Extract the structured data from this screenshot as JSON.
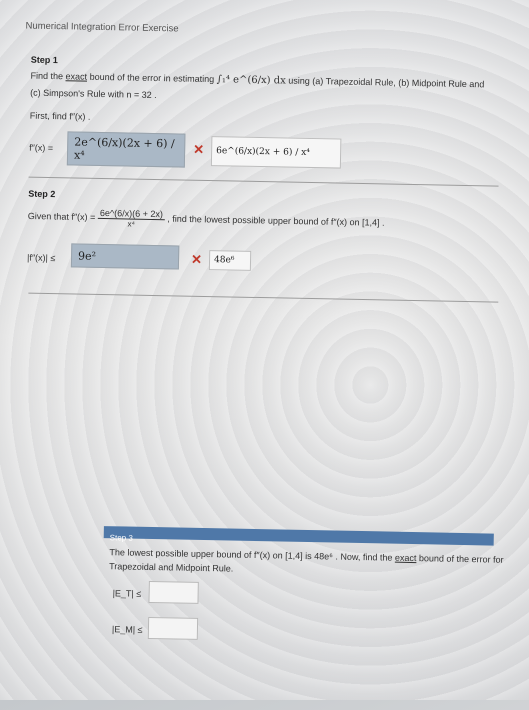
{
  "header": {
    "title": "Numerical Integration Error Exercise"
  },
  "step1": {
    "label": "Step 1",
    "instruction_a": "Find the",
    "instruction_b": "exact",
    "instruction_c": "bound of the error in estimating",
    "integral": "∫₁⁴ e^(6/x) dx",
    "instruction_d": "using (a) Trapezoidal Rule, (b) Midpoint Rule and",
    "instruction_e": "(c) Simpson's Rule with  n = 32 .",
    "first_find": "First, find  f″(x) .",
    "fpp_label": "f″(x) =",
    "answer_entered": "2e^(6/x)(2x + 6) / x⁴",
    "answer_correct": "6e^(6/x)(2x + 6) / x⁴"
  },
  "step2": {
    "label": "Step 2",
    "given_a": "Given that  f″(x) =",
    "given_expr_num": "6e^(6/x)(6 + 2x)",
    "given_expr_den": "x⁴",
    "given_b": ", find the lowest possible upper bound of  f″(x)  on [1,4] .",
    "bound_label": "|f″(x)| ≤",
    "bound_entered": "9e²",
    "bound_correct": "48e⁶"
  },
  "step3": {
    "label": "Step 3",
    "text_a": "The lowest possible upper bound of  f″(x)  on [1,4]  is  48e⁶ .  Now, find the",
    "text_b": "exact",
    "text_c": "bound of the error for",
    "text_d": "Trapezoidal and Midpoint Rule.",
    "et_label": "|E_T| ≤",
    "em_label": "|E_M| ≤",
    "et_value": "",
    "em_value": ""
  },
  "colors": {
    "wrong": "#c0392b",
    "step3_bar": "#4f78a8",
    "answer_fill": "#aab8c6"
  }
}
